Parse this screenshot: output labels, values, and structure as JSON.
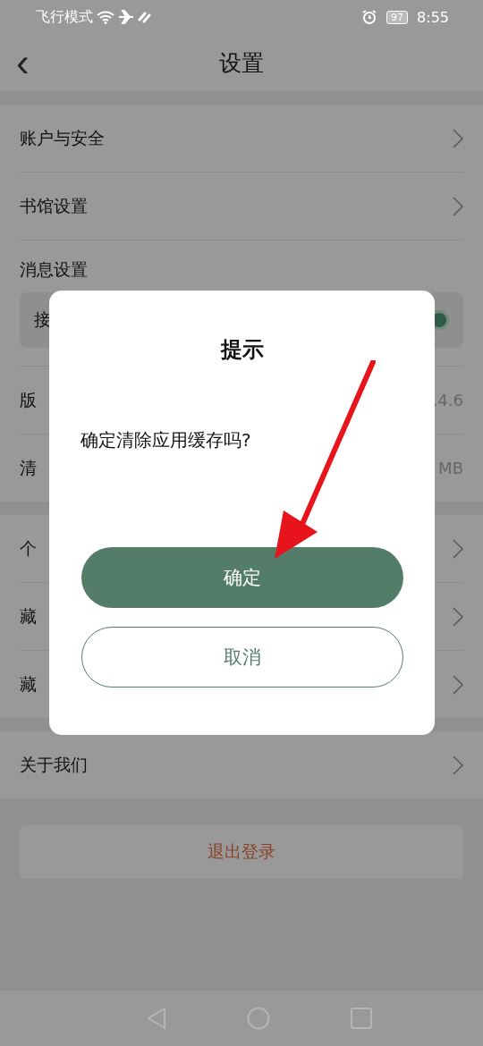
{
  "status_bar": {
    "mode": "飞行模式",
    "battery": "97",
    "time": "8:55"
  },
  "header": {
    "back": "‹",
    "title": "设置"
  },
  "groups": [
    {
      "rows": [
        {
          "kind": "link",
          "label": "账户与安全"
        },
        {
          "kind": "link",
          "label": "书馆设置"
        },
        {
          "kind": "section",
          "label": "消息设置",
          "sub": {
            "label": "接",
            "on": true
          }
        },
        {
          "kind": "value",
          "label": "版",
          "value": ".4.6"
        },
        {
          "kind": "value",
          "label": "清",
          "value": "MB"
        }
      ]
    },
    {
      "rows": [
        {
          "kind": "link",
          "label": "个"
        },
        {
          "kind": "link",
          "label": "藏"
        },
        {
          "kind": "link",
          "label": "藏"
        }
      ]
    },
    {
      "rows": [
        {
          "kind": "link",
          "label": "关于我们"
        }
      ]
    }
  ],
  "logout": "退出登录",
  "dialog": {
    "title": "提示",
    "message": "确定清除应用缓存吗?",
    "confirm": "确定",
    "cancel": "取消"
  }
}
